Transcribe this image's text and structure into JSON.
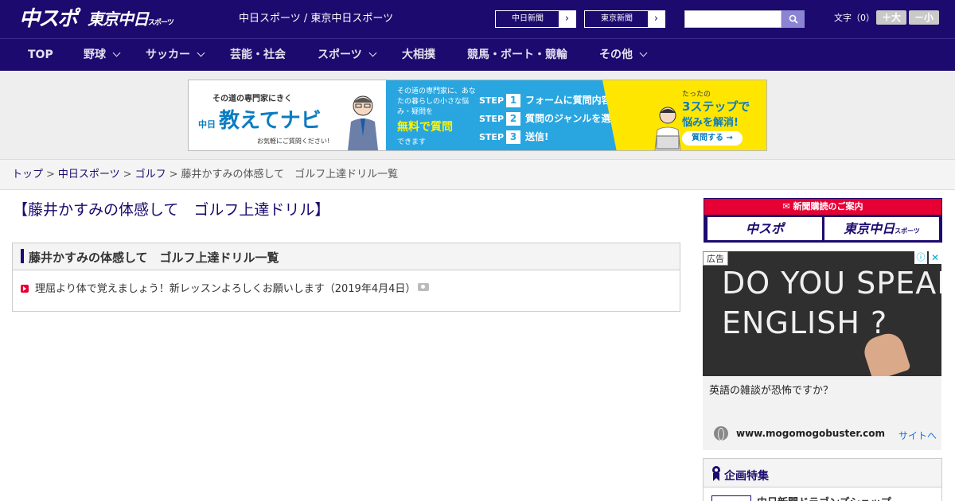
{
  "header": {
    "logo_chuspo": "中スポ",
    "logo_tokyo": "東京中日",
    "logo_tokyo_sub": "スポーツ",
    "tagline": "中日スポーツ / 東京中日スポーツ",
    "btn_chunichi": "中日新聞",
    "btn_tokyo": "東京新聞",
    "search_placeholder": "",
    "fontsize_label": "文字（0）",
    "fontsize_large": "＋大",
    "fontsize_small": "－小"
  },
  "nav": {
    "items": [
      {
        "label": "TOP"
      },
      {
        "label": "野球"
      },
      {
        "label": "サッカー"
      },
      {
        "label": "芸能・社会"
      },
      {
        "label": "スポーツ"
      },
      {
        "label": "大相撲"
      },
      {
        "label": "競馬・ボート・競輪"
      },
      {
        "label": "その他"
      }
    ]
  },
  "banner": {
    "tag": "その道の専門家にきく",
    "title_prefix": "中日",
    "title": "教えてナビ",
    "footnote": "お気軽にご質問ください!",
    "mid_text": "その道の専門家に、あなたの暮らしの小さな悩み・疑問を",
    "mid_free": "無料で質問",
    "mid_dekimasu": "できます",
    "steps": [
      {
        "word": "STEP",
        "num": "1",
        "text": "フォームに質問内容を入力"
      },
      {
        "word": "STEP",
        "num": "2",
        "text": "質問のジャンルを選択"
      },
      {
        "word": "STEP",
        "num": "3",
        "text": "送信!"
      }
    ],
    "right_small": "たったの",
    "right_big": "3ステップで",
    "right_big2": "悩みを解消!",
    "right_button": "質問する →"
  },
  "breadcrumb": {
    "items": [
      "トップ",
      "中日スポーツ",
      "ゴルフ"
    ],
    "current": "藤井かすみの体感して　ゴルフ上達ドリル一覧",
    "separator": ">"
  },
  "main": {
    "page_title": "【藤井かすみの体感して　ゴルフ上達ドリル】",
    "list_heading": "藤井かすみの体感して　ゴルフ上達ドリル一覧",
    "articles": [
      {
        "title": "理屈より体で覚えましょう！新レッスンよろしくお願いします（2019年4月4日）"
      }
    ]
  },
  "sidebar": {
    "subscribe_heading": "新聞購読のご案内",
    "subscribe_chuspo": "中スポ",
    "subscribe_tokyo": "東京中日",
    "subscribe_tokyo_sub": "スポーツ",
    "ad": {
      "label": "広告",
      "chalk_line1": "DO YOU SPEAK",
      "chalk_line2": "ENGLISH ?",
      "headline": "英語の雑談が恐怖ですか？",
      "domain": "www.mogomogobuster.com",
      "site_link": "サイトへ"
    },
    "feature_heading": "企画特集",
    "feature_item": "中日新聞ドラゴンズショップ"
  },
  "colors": {
    "brand_navy": "#1c0a6e",
    "accent_red": "#e60033",
    "banner_blue": "#29a6e0",
    "banner_yellow": "#ffe600"
  }
}
